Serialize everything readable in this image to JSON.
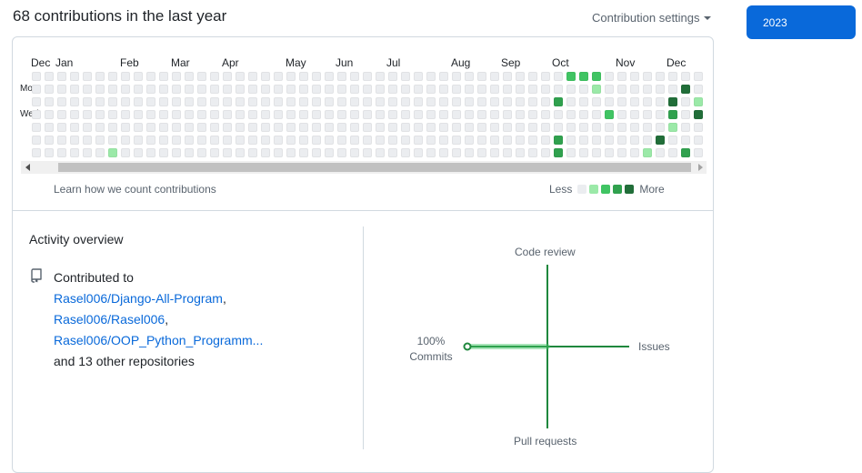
{
  "header": {
    "contributions_headline": "68 contributions in the last year",
    "settings_label": "Contribution settings"
  },
  "year_selector": {
    "selected_year": "2023"
  },
  "calendar": {
    "months": [
      "Dec",
      "Jan",
      "Feb",
      "Mar",
      "Apr",
      "May",
      "Jun",
      "Jul",
      "Aug",
      "Sep",
      "Oct",
      "Nov",
      "Dec"
    ],
    "day_labels": [
      "Mon",
      "Wed"
    ],
    "learn_link": "Learn how we count contributions",
    "legend_less": "Less",
    "legend_more": "More",
    "level_colors": [
      "#ebedf0",
      "#9be9a8",
      "#40c463",
      "#30a14e",
      "#216e39"
    ],
    "weeks": 53,
    "active_days": [
      {
        "week": 6,
        "day": 6,
        "level": 1
      },
      {
        "week": 41,
        "day": 2,
        "level": 3
      },
      {
        "week": 41,
        "day": 5,
        "level": 3
      },
      {
        "week": 41,
        "day": 6,
        "level": 3
      },
      {
        "week": 42,
        "day": 0,
        "level": 2
      },
      {
        "week": 43,
        "day": 0,
        "level": 2
      },
      {
        "week": 44,
        "day": 0,
        "level": 2
      },
      {
        "week": 44,
        "day": 1,
        "level": 1
      },
      {
        "week": 45,
        "day": 3,
        "level": 2
      },
      {
        "week": 48,
        "day": 6,
        "level": 1
      },
      {
        "week": 49,
        "day": 5,
        "level": 4
      },
      {
        "week": 50,
        "day": 2,
        "level": 4
      },
      {
        "week": 50,
        "day": 3,
        "level": 3
      },
      {
        "week": 50,
        "day": 4,
        "level": 1
      },
      {
        "week": 51,
        "day": 1,
        "level": 4
      },
      {
        "week": 51,
        "day": 6,
        "level": 3
      },
      {
        "week": 52,
        "day": 2,
        "level": 1
      },
      {
        "week": 52,
        "day": 3,
        "level": 4
      }
    ]
  },
  "activity": {
    "title": "Activity overview",
    "contributed_to": "Contributed to",
    "repos": [
      "Rasel006/Django-All-Program",
      "Rasel006/Rasel006",
      "Rasel006/OOP_Python_Programm..."
    ],
    "other_repos": "and 13 other repositories",
    "repo_icon": "repo-icon"
  },
  "overview_chart": {
    "code_review_label": "Code review",
    "issues_label": "Issues",
    "pull_requests_label": "Pull requests",
    "commits_percent": "100%",
    "commits_label": "Commits",
    "commits_fraction": 1.0,
    "line_color": "#1f883d",
    "highlight_color": "#40c463"
  }
}
